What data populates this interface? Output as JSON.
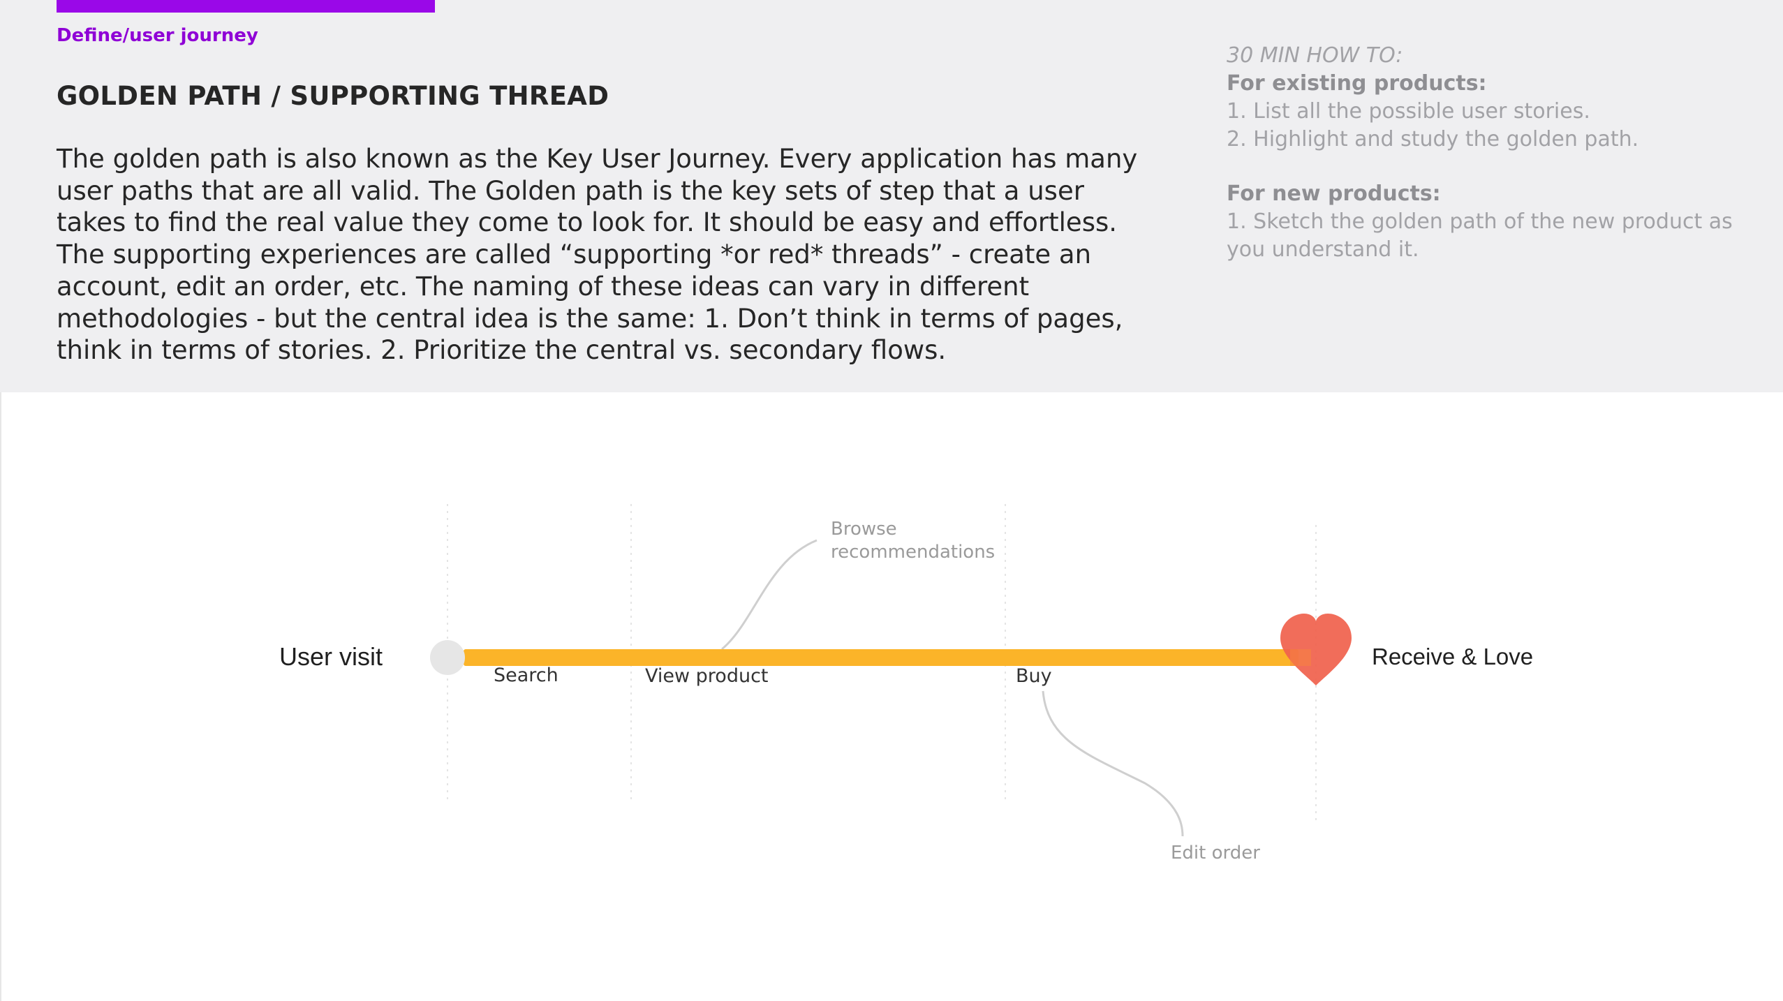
{
  "header": {
    "section_label": "Define/user journey",
    "title": "GOLDEN PATH / SUPPORTING THREAD",
    "intro_lines": [
      "The golden path is also known as the Key User Journey. Every application has many",
      "user paths that are all valid. The Golden path is the key sets of step that a user",
      "takes to find the real value they come to look for. It should be easy and effortless.",
      "The supporting experiences are called “supporting *or red* threads” - create an",
      "account, edit an order, etc. The naming of these ideas can vary in different",
      "methodologies - but the central idea is the same: 1. Don’t think in terms of pages,",
      "think in terms of stories. 2. Prioritize the central vs. secondary flows."
    ]
  },
  "howto": {
    "heading": "30 MIN HOW TO:",
    "existing_title": "For existing products:",
    "existing_steps": [
      "1. List all the possible user stories.",
      "2. Highlight and study the golden path."
    ],
    "new_title": "For new products:",
    "new_steps": [
      "1. Sketch the golden path of the new product as",
      "you understand it."
    ]
  },
  "diagram": {
    "start_label": "User visit",
    "end_label": "Receive & Love",
    "steps": [
      "Search",
      "View product",
      "Buy"
    ],
    "branch_up_lines": [
      "Browse",
      "recommendations"
    ],
    "branch_down": "Edit order",
    "colors": {
      "path": "#fbb429",
      "heart": "#f0624e",
      "accent": "#9a08e8",
      "branch_line": "#cfcfcf",
      "start_dot": "#e6e6e6"
    }
  }
}
